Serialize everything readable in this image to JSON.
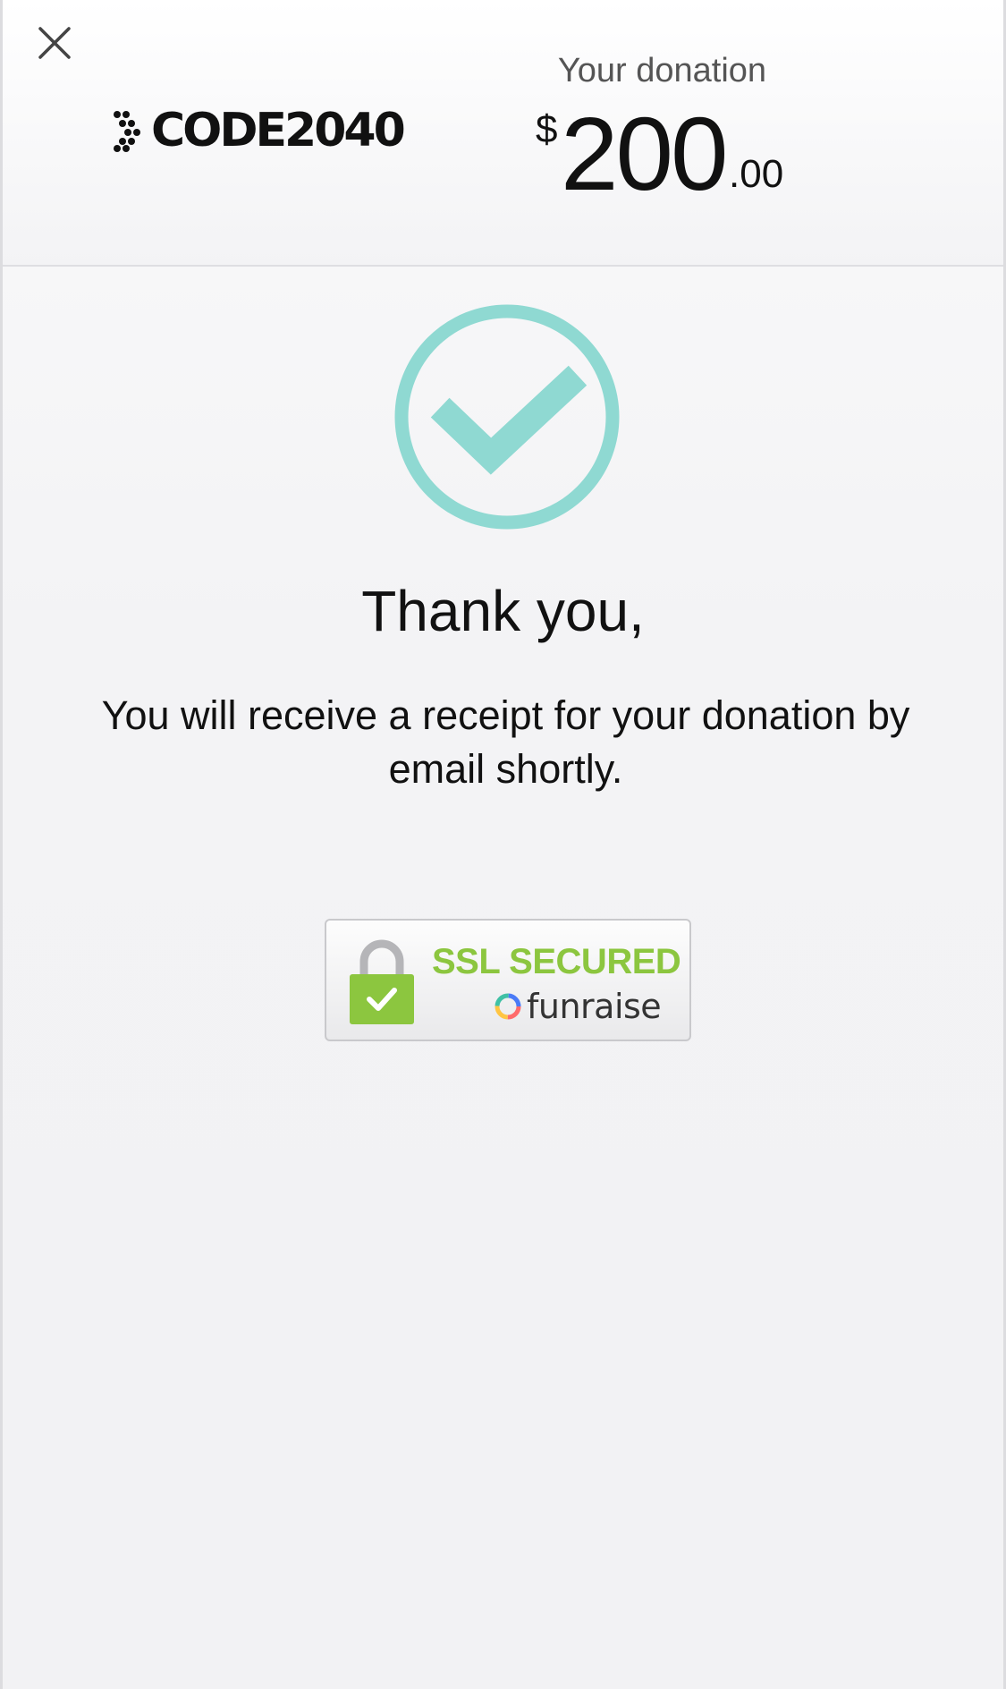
{
  "header": {
    "logo_text": "CODE2040",
    "donation_label": "Your donation",
    "amount": {
      "currency": "$",
      "whole": "200",
      "cents": ".00"
    }
  },
  "confirmation": {
    "title": "Thank you,",
    "message": "You will receive a receipt for your donation by email shortly."
  },
  "badge": {
    "title": "SSL SECURED",
    "brand": "funraise"
  },
  "colors": {
    "check_accent": "#8fd9d2",
    "ssl_green": "#8cc63f"
  },
  "icons": {
    "close": "close-icon",
    "check": "check-circle-icon",
    "lock": "lock-icon"
  }
}
